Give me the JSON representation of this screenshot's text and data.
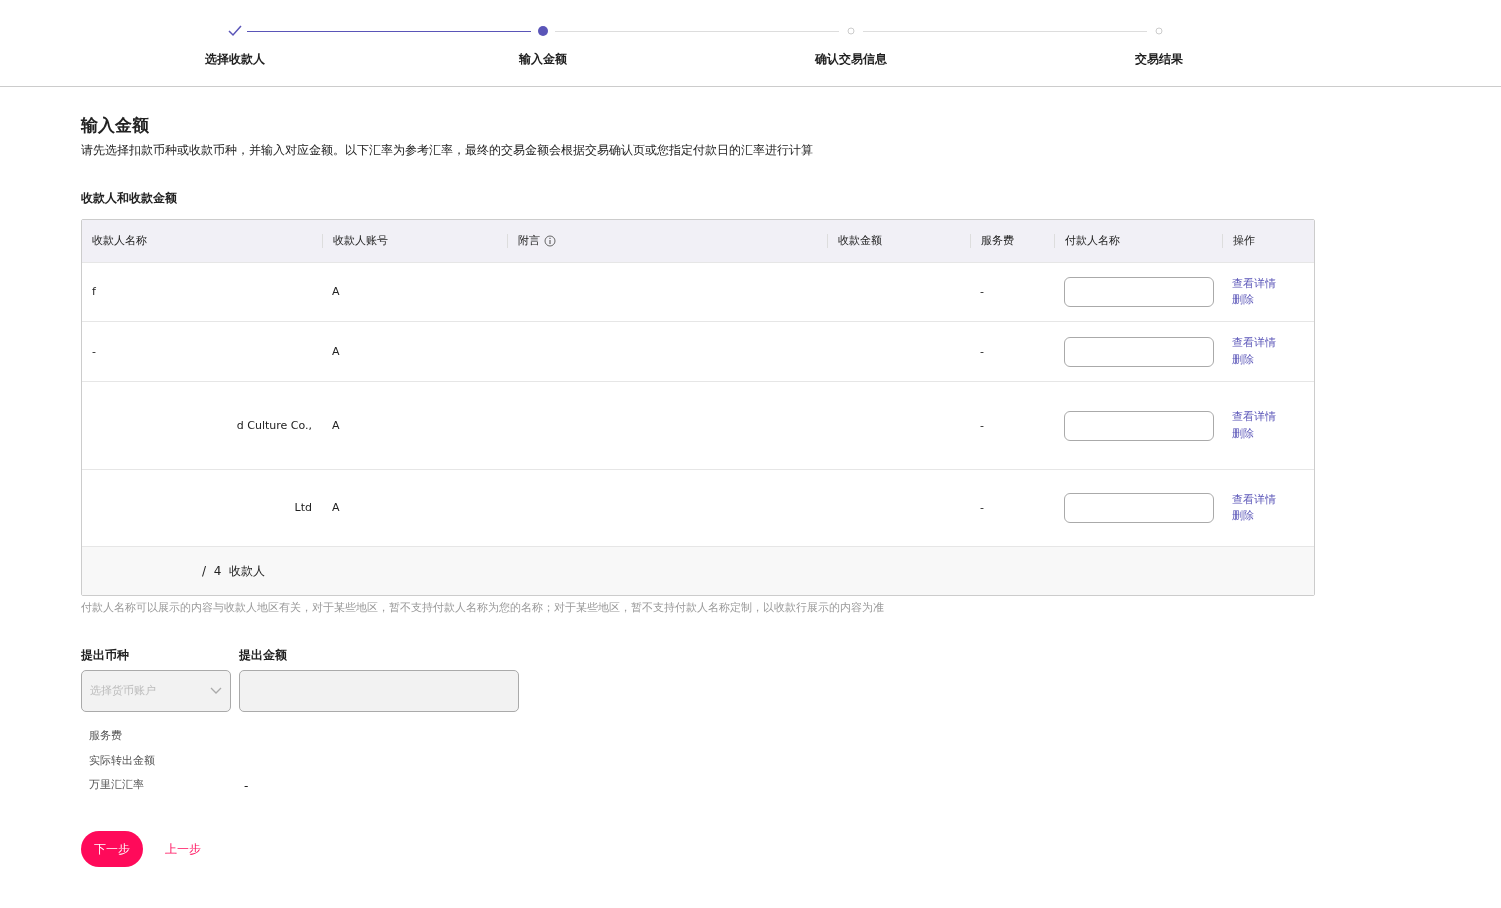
{
  "steps": [
    {
      "label": "选择收款人",
      "kind": "done"
    },
    {
      "label": "输入金额",
      "kind": "current"
    },
    {
      "label": "确认交易信息",
      "kind": "pending"
    },
    {
      "label": "交易结果",
      "kind": "pending"
    }
  ],
  "title": "输入金额",
  "description": "请先选择扣款币种或收款币种，并输入对应金额。以下汇率为参考汇率，最终的交易金额会根据交易确认页或您指定付款日的汇率进行计算",
  "section_title": "收款人和收款金额",
  "table": {
    "columns": [
      "收款人名称",
      "收款人账号",
      "附言",
      "收款金额",
      "服务费",
      "付款人名称",
      "操作"
    ],
    "rows": [
      {
        "name": "f",
        "account": "A",
        "fee": "-",
        "actions": [
          "查看详情",
          "删除"
        ]
      },
      {
        "name": "-",
        "account": "A",
        "fee": "-",
        "actions": [
          "查看详情",
          "删除"
        ]
      },
      {
        "name": "d Culture Co.,",
        "account": "A",
        "fee": "-",
        "actions": [
          "查看详情",
          "删除"
        ]
      },
      {
        "name": "Ltd",
        "account": "A",
        "fee": "-",
        "actions": [
          "查看详情",
          "删除"
        ]
      }
    ],
    "footer": "/  4  收款人"
  },
  "note": "付款人名称可以展示的内容与收款人地区有关，对于某些地区，暂不支持付款人名称为您的名称；对于某些地区，暂不支持付款人名称定制，以收款行展示的内容为准",
  "currency": {
    "label": "提出币种",
    "placeholder": "选择货币账户"
  },
  "amount": {
    "label": "提出金额"
  },
  "summary": [
    {
      "label": "服务费"
    },
    {
      "label": "实际转出金额"
    },
    {
      "label": "万里汇汇率",
      "value": "-"
    }
  ],
  "buttons": {
    "next": "下一步",
    "back": "上一步"
  }
}
